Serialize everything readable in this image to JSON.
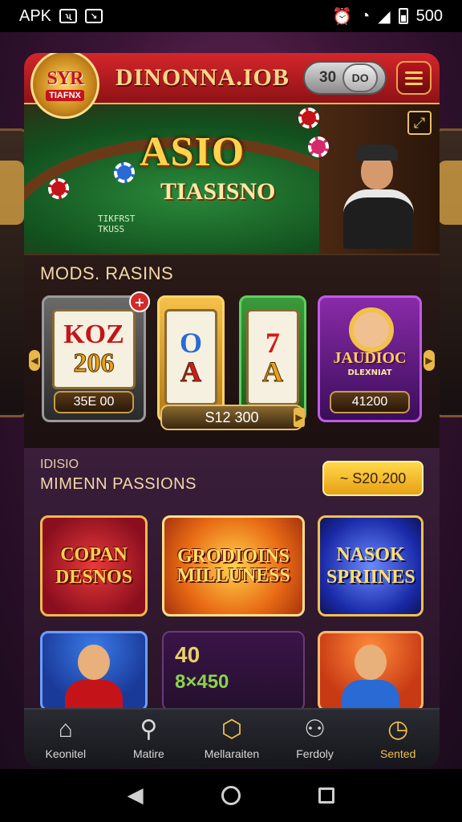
{
  "status_bar": {
    "app_label": "APK",
    "battery_text": "500"
  },
  "header": {
    "logo_line1": "SYR",
    "logo_line2": "TIAFNX",
    "brand": "DINONNA.IOB",
    "balance_value": "30",
    "balance_unit": "DO"
  },
  "hero": {
    "title": "ASIO",
    "subtitle": "TIASISNO",
    "table_text": "TIKFRST\nTKUSS"
  },
  "slots": {
    "section_title": "MODS. RASINS",
    "machines": [
      {
        "line1": "KOZ",
        "line2": "206",
        "value": "35E 00",
        "badge": "+"
      },
      {
        "line1": "O",
        "line2": "A"
      },
      {
        "line1": "7",
        "line2": "A"
      },
      {
        "title": "JAUDIOC",
        "subtitle": "DLEXNIAT",
        "value": "41200"
      }
    ],
    "jackpot": "S12 300"
  },
  "popular": {
    "section_super": "IDISIO",
    "section_title": "MIMENN PASSIONS",
    "cta_label": "~ S20.200",
    "games": [
      {
        "title": "COPAN DESNOS"
      },
      {
        "title": "GRODIOINS MILLUNESS"
      },
      {
        "title": "NASOK SPRIINES"
      },
      {
        "title": ""
      },
      {
        "line1": "40",
        "line2": "8×450"
      },
      {
        "title": ""
      }
    ]
  },
  "bottom_nav": [
    {
      "label": "Keonitel",
      "icon": "home-icon"
    },
    {
      "label": "Matire",
      "icon": "search-icon"
    },
    {
      "label": "Mellaraiten",
      "icon": "wallet-icon"
    },
    {
      "label": "Ferdoly",
      "icon": "people-icon"
    },
    {
      "label": "Sented",
      "icon": "timer-icon",
      "active": true
    }
  ],
  "colors": {
    "header_red": "#d4262a",
    "accent_gold": "#f2c14a",
    "panel_dark": "#24131f"
  }
}
